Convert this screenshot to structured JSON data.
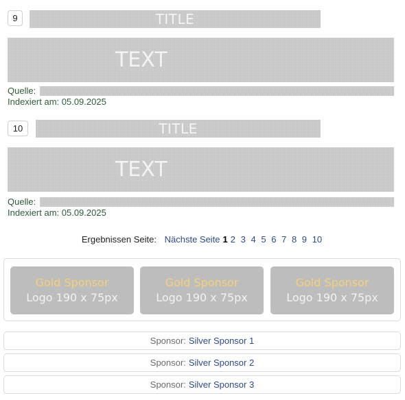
{
  "results": [
    {
      "number": "9",
      "title": "TITLE",
      "text": "TEXT",
      "source_label": "Quelle:",
      "indexed": "Indexiert am: 05.09.2025"
    },
    {
      "number": "10",
      "title": "TITLE",
      "text": "TEXT",
      "source_label": "Quelle:",
      "indexed": "Indexiert am: 05.09.2025"
    }
  ],
  "pagination": {
    "label": "Ergebnissen Seite:",
    "next": "Nächste Seite",
    "current": "1",
    "pages": [
      "2",
      "3",
      "4",
      "5",
      "6",
      "7",
      "8",
      "9",
      "10"
    ]
  },
  "gold_sponsors": [
    {
      "line1": "Gold Sponsor",
      "line2": "Logo 190 x 75px"
    },
    {
      "line1": "Gold Sponsor",
      "line2": "Logo 190 x 75px"
    },
    {
      "line1": "Gold Sponsor",
      "line2": "Logo 190 x 75px"
    }
  ],
  "silver_sponsors": [
    {
      "label": "Sponsor:",
      "name": "Silver Sponsor 1"
    },
    {
      "label": "Sponsor:",
      "name": "Silver Sponsor 2"
    },
    {
      "label": "Sponsor:",
      "name": "Silver Sponsor 3"
    }
  ],
  "colors": {
    "meta_text": "#2f5b3a",
    "link": "#2d4a8a",
    "placeholder_gray": "#bdbdbd",
    "gold_text": "#f5d27a"
  }
}
